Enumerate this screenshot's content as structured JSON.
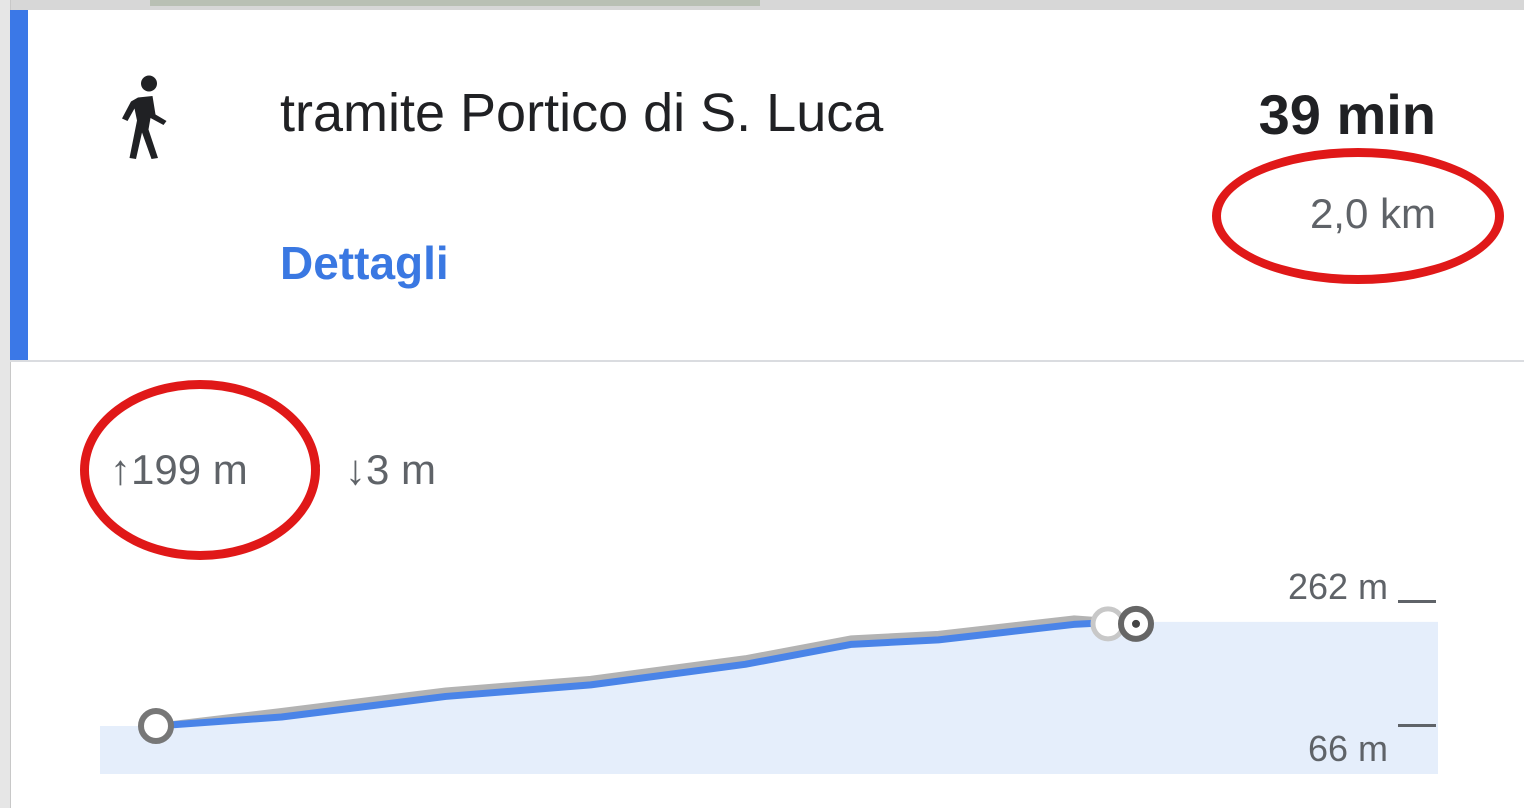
{
  "route": {
    "mode_icon": "walk-icon",
    "title": "tramite Portico di S. Luca",
    "duration": "39 min",
    "distance": "2,0 km",
    "details_label": "Dettagli",
    "selected_color": "#3b78e7"
  },
  "elevation": {
    "ascent": "↑199 m",
    "descent": "↓3 m",
    "max_label": "262 m",
    "min_label": "66 m",
    "profile": {
      "x": [
        0,
        0.13,
        0.3,
        0.45,
        0.61,
        0.72,
        0.81,
        0.95,
        1.0
      ],
      "elevation_m": [
        66,
        80,
        112,
        130,
        162,
        193,
        200,
        224,
        228
      ]
    },
    "line_color": "#4a84e8",
    "fill_color": "#e5eefb"
  },
  "annotations": {
    "color": "#e01818",
    "marked": [
      "distance",
      "ascent"
    ]
  }
}
